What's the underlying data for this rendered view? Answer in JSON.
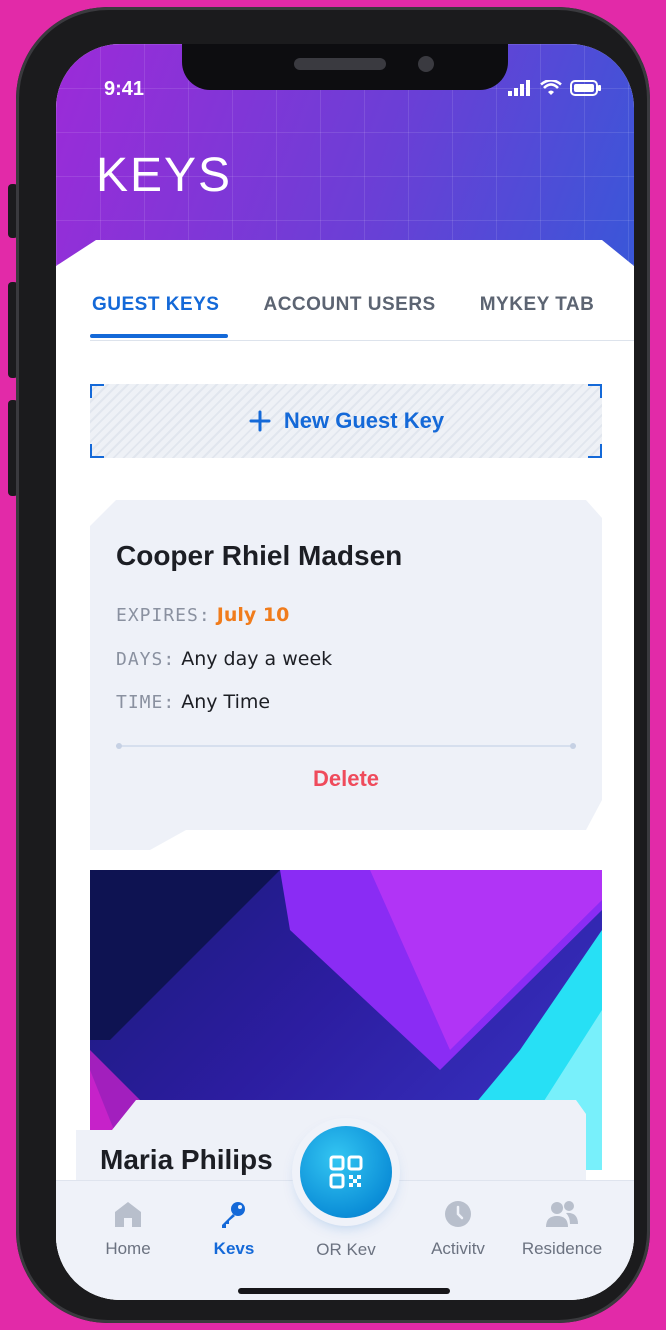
{
  "status_bar": {
    "time": "9:41"
  },
  "header": {
    "title": "KEYS"
  },
  "tabs": [
    {
      "label": "GUEST KEYS",
      "active": true
    },
    {
      "label": "ACCOUNT USERS",
      "active": false
    },
    {
      "label": "MYKEY TAB",
      "active": false
    }
  ],
  "new_key": {
    "label": "New Guest Key",
    "icon": "plus-icon"
  },
  "guest_card": {
    "name": "Cooper Rhiel Madsen",
    "expires_label": "EXPIRES:",
    "expires_value": "July 10",
    "days_label": "DAYS:",
    "days_value": "Any day a week",
    "time_label": "TIME:",
    "time_value": "Any Time",
    "delete_label": "Delete"
  },
  "second_card": {
    "name": "Maria Philips"
  },
  "bottom_nav": {
    "home": "Home",
    "keys": "Kevs",
    "qr_key": "OR Kev",
    "activity": "Activitv",
    "residence": "Residence"
  },
  "colors": {
    "accent": "#1469d8",
    "delete": "#ef4b5c",
    "expires": "#f07c1c",
    "background": "#e22aa8"
  }
}
